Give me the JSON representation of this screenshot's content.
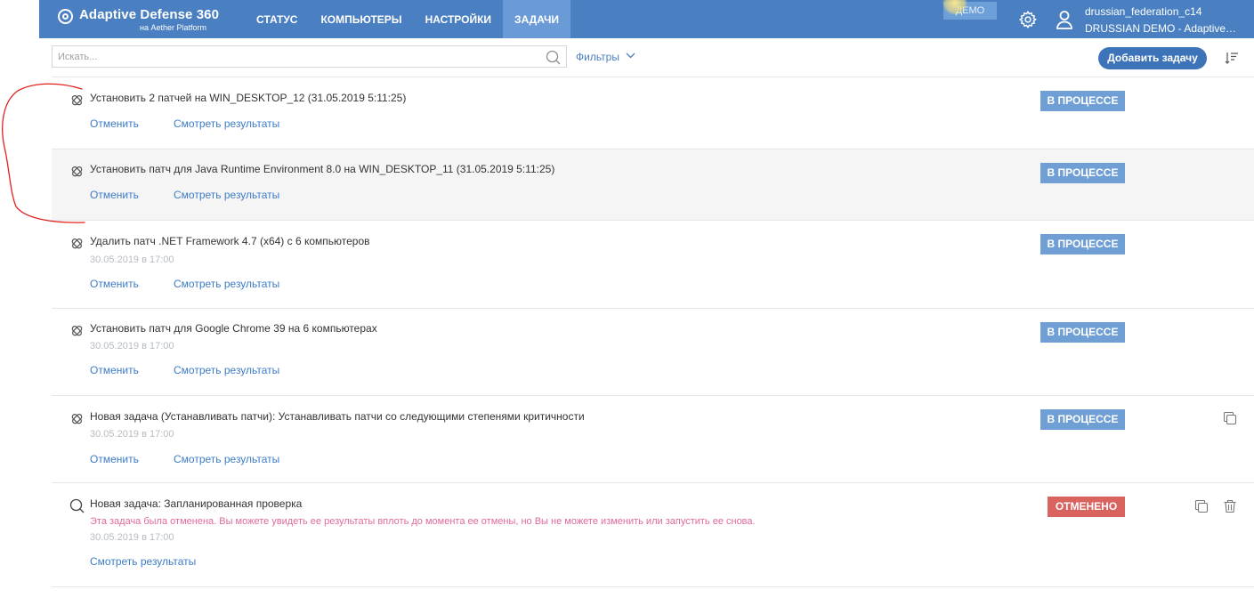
{
  "header": {
    "brand_title": "Adaptive Defense 360",
    "brand_subtitle": "на Aether Platform",
    "nav": [
      "СТАТУС",
      "КОМПЬЮТЕРЫ",
      "НАСТРОЙКИ",
      "ЗАДАЧИ"
    ],
    "active_nav": "ЗАДАЧИ",
    "demo_badge": "ДЕМО",
    "user_name": "drussian_federation_c14",
    "user_org": "DRUSSIAN DEMO - Adaptive…",
    "icons": [
      "logo-icon",
      "gear-icon",
      "user-icon"
    ]
  },
  "toolbar": {
    "search_placeholder": "Искать...",
    "filters_label": "Фильтры",
    "add_task_label": "Добавить задачу",
    "icons": [
      "search-icon",
      "chevron-down-icon",
      "sort-icon"
    ]
  },
  "tasks": [
    {
      "icon": "patch-icon",
      "title": "Установить 2 патчей на WIN_DESKTOP_12 (31.05.2019 5:11:25)",
      "status": "В ПРОЦЕССЕ",
      "cancel_label": "Отменить",
      "results_label": "Смотреть результаты"
    },
    {
      "icon": "patch-icon",
      "title": "Установить патч для Java Runtime Environment 8.0 на WIN_DESKTOP_11 (31.05.2019 5:11:25)",
      "status": "В ПРОЦЕССЕ",
      "cancel_label": "Отменить",
      "results_label": "Смотреть результаты"
    },
    {
      "icon": "patch-icon",
      "title": "Удалить патч .NET Framework 4.7 (x64) с 6 компьютеров",
      "date": "30.05.2019 в 17:00",
      "status": "В ПРОЦЕССЕ",
      "cancel_label": "Отменить",
      "results_label": "Смотреть результаты"
    },
    {
      "icon": "patch-icon",
      "title": "Установить патч для Google Chrome 39 на 6 компьютерах",
      "date": "30.05.2019 в 17:00",
      "status": "В ПРОЦЕССЕ",
      "cancel_label": "Отменить",
      "results_label": "Смотреть результаты"
    },
    {
      "icon": "patch-icon",
      "title": "Новая задача (Устанавливать патчи): Устанавливать патчи со следующими степенями критичности",
      "date": "30.05.2019 в 17:00",
      "status": "В ПРОЦЕССЕ",
      "cancel_label": "Отменить",
      "results_label": "Смотреть результаты",
      "actions": [
        "copy-icon"
      ]
    },
    {
      "icon": "scan-icon",
      "title": "Новая задача: Запланированная проверка",
      "warning": "Эта задача была отменена. Вы можете увидеть ее результаты вплоть до момента ее отмены, но Вы не можете изменить или запустить ее снова.",
      "date": "30.05.2019 в 17:00",
      "status": "ОТМЕНЕНО",
      "results_label": "Смотреть результаты",
      "actions": [
        "copy-icon",
        "trash-icon"
      ]
    }
  ],
  "colors": {
    "header_bg": "#4a7fc1",
    "active_tab_bg": "#6b9bd6",
    "link": "#3d7cc6",
    "status_progress": "#6f9fd4",
    "status_canceled": "#d9635f",
    "warning_text": "#e0699c",
    "annotation_stroke": "#e0201c"
  }
}
